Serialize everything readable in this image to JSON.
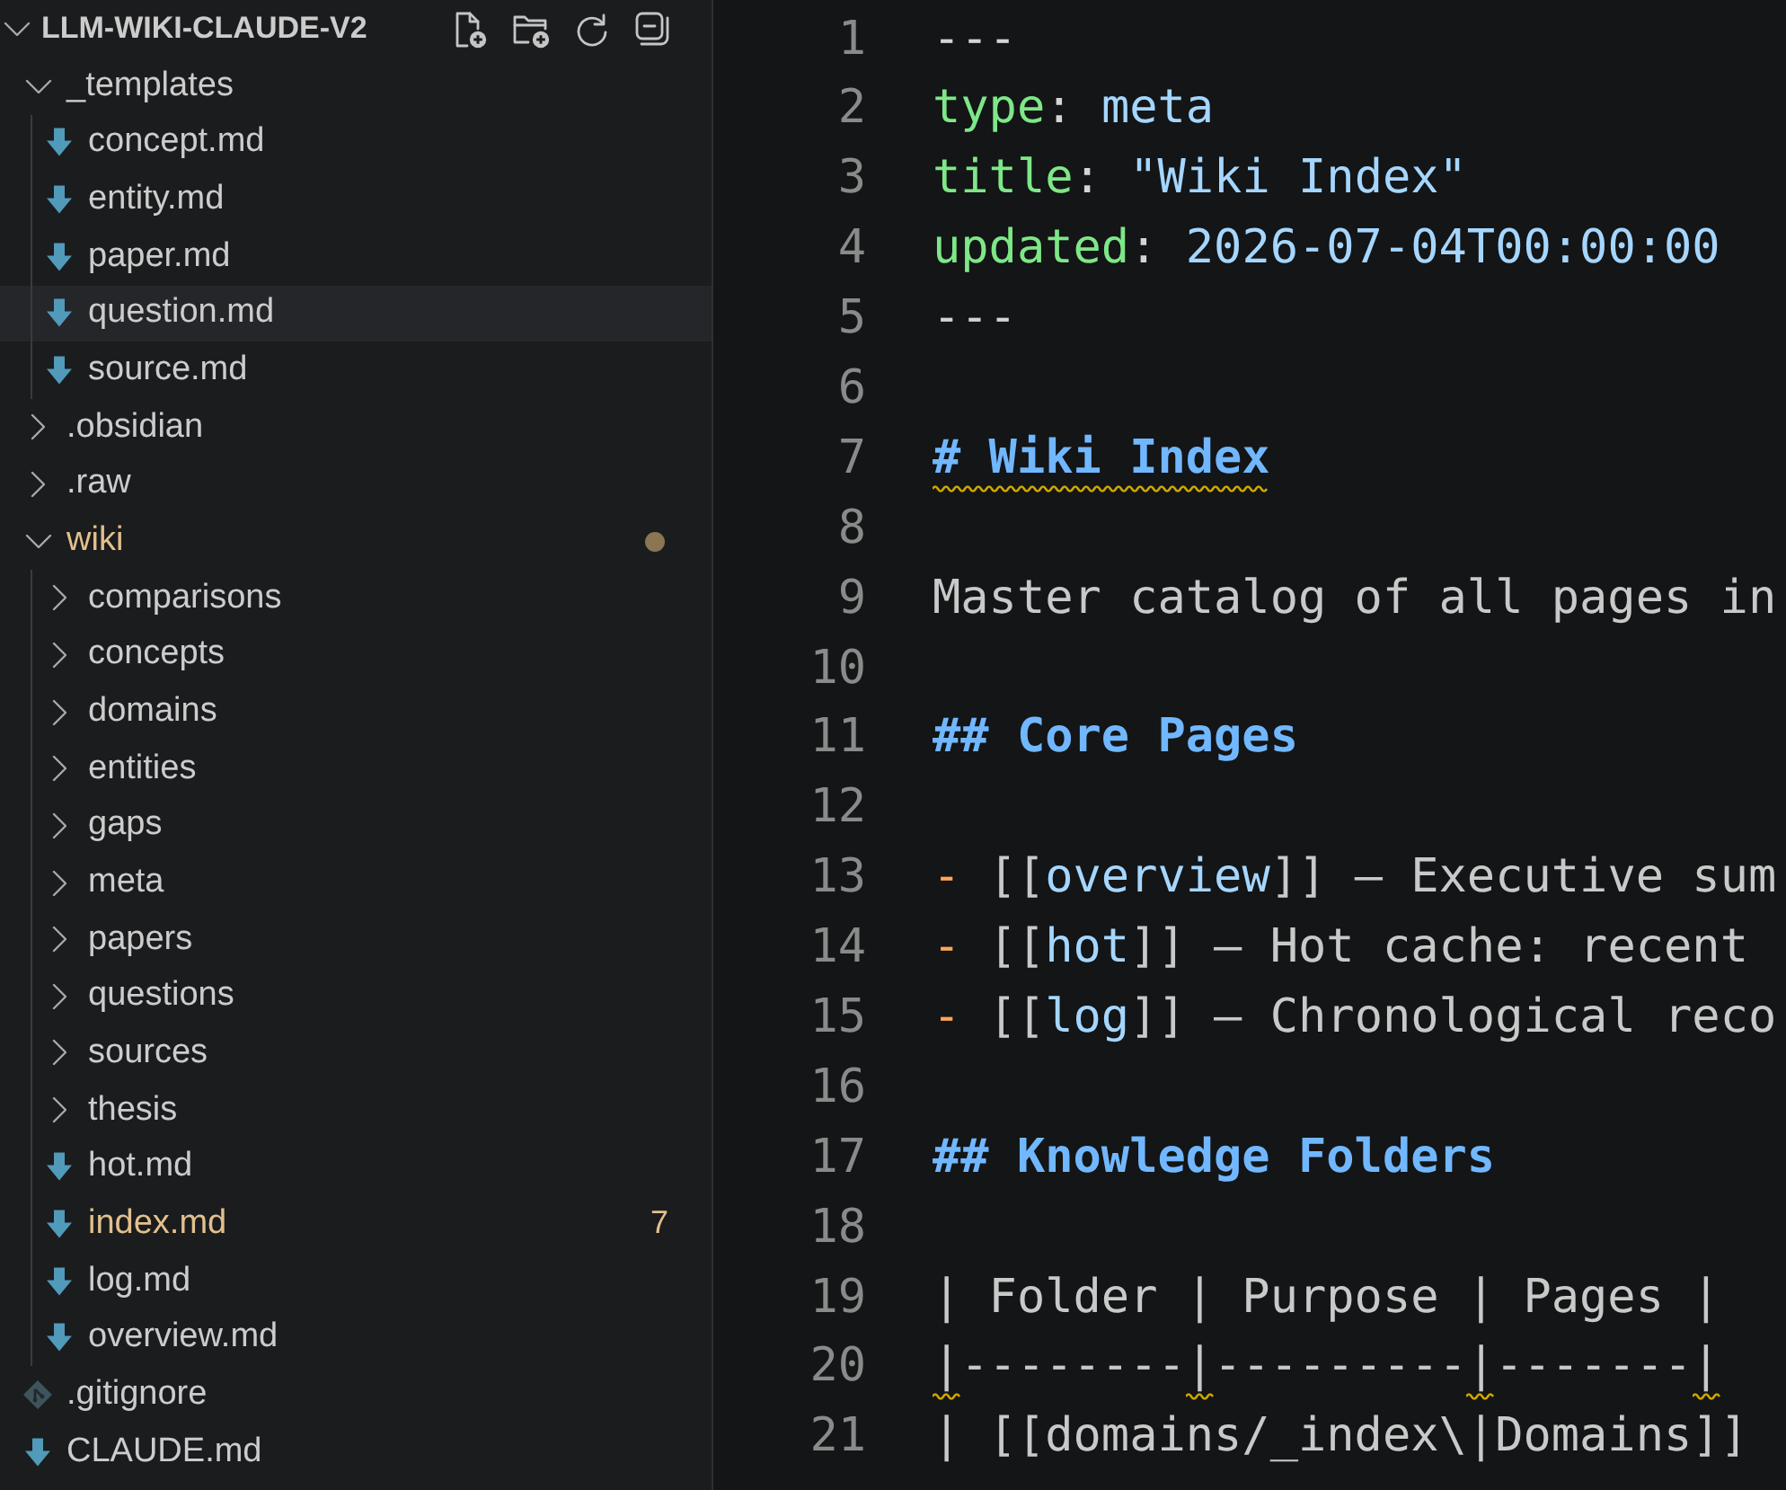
{
  "explorer": {
    "title": "LLM-WIKI-CLAUDE-V2",
    "expanded": true,
    "tree": [
      {
        "name": "_templates",
        "kind": "folder",
        "expanded": true,
        "selected": false,
        "modified": false,
        "children": [
          {
            "name": "concept.md",
            "kind": "markdown",
            "selected": false,
            "modified": false
          },
          {
            "name": "entity.md",
            "kind": "markdown",
            "selected": false,
            "modified": false
          },
          {
            "name": "paper.md",
            "kind": "markdown",
            "selected": false,
            "modified": false
          },
          {
            "name": "question.md",
            "kind": "markdown",
            "selected": true,
            "modified": false
          },
          {
            "name": "source.md",
            "kind": "markdown",
            "selected": false,
            "modified": false
          }
        ]
      },
      {
        "name": ".obsidian",
        "kind": "folder",
        "expanded": false,
        "selected": false,
        "modified": false
      },
      {
        "name": ".raw",
        "kind": "folder",
        "expanded": false,
        "selected": false,
        "modified": false
      },
      {
        "name": "wiki",
        "kind": "folder",
        "expanded": true,
        "selected": false,
        "modified": true,
        "children": [
          {
            "name": "comparisons",
            "kind": "folder",
            "expanded": false,
            "selected": false,
            "modified": false
          },
          {
            "name": "concepts",
            "kind": "folder",
            "expanded": false,
            "selected": false,
            "modified": false
          },
          {
            "name": "domains",
            "kind": "folder",
            "expanded": false,
            "selected": false,
            "modified": false
          },
          {
            "name": "entities",
            "kind": "folder",
            "expanded": false,
            "selected": false,
            "modified": false
          },
          {
            "name": "gaps",
            "kind": "folder",
            "expanded": false,
            "selected": false,
            "modified": false
          },
          {
            "name": "meta",
            "kind": "folder",
            "expanded": false,
            "selected": false,
            "modified": false
          },
          {
            "name": "papers",
            "kind": "folder",
            "expanded": false,
            "selected": false,
            "modified": false
          },
          {
            "name": "questions",
            "kind": "folder",
            "expanded": false,
            "selected": false,
            "modified": false
          },
          {
            "name": "sources",
            "kind": "folder",
            "expanded": false,
            "selected": false,
            "modified": false
          },
          {
            "name": "thesis",
            "kind": "folder",
            "expanded": false,
            "selected": false,
            "modified": false
          },
          {
            "name": "hot.md",
            "kind": "markdown",
            "selected": false,
            "modified": false
          },
          {
            "name": "index.md",
            "kind": "markdown",
            "selected": false,
            "modified": true,
            "badge": "7"
          },
          {
            "name": "log.md",
            "kind": "markdown",
            "selected": false,
            "modified": false
          },
          {
            "name": "overview.md",
            "kind": "markdown",
            "selected": false,
            "modified": false
          }
        ]
      },
      {
        "name": ".gitignore",
        "kind": "gitignore",
        "selected": false,
        "modified": false
      },
      {
        "name": "CLAUDE.md",
        "kind": "markdown",
        "selected": false,
        "modified": false
      }
    ]
  },
  "editor": {
    "lines": [
      {
        "number": "1",
        "tokens": [
          {
            "kind": "punct",
            "text": "---"
          }
        ]
      },
      {
        "number": "2",
        "tokens": [
          {
            "kind": "key",
            "text": "type"
          },
          {
            "kind": "punct",
            "text": ": "
          },
          {
            "kind": "value",
            "text": "meta"
          }
        ]
      },
      {
        "number": "3",
        "tokens": [
          {
            "kind": "key",
            "text": "title"
          },
          {
            "kind": "punct",
            "text": ": "
          },
          {
            "kind": "value",
            "text": "\"Wiki Index\""
          }
        ]
      },
      {
        "number": "4",
        "tokens": [
          {
            "kind": "key",
            "text": "updated"
          },
          {
            "kind": "punct",
            "text": ": "
          },
          {
            "kind": "value",
            "text": "2026-07-04T00:00:00"
          }
        ]
      },
      {
        "number": "5",
        "tokens": [
          {
            "kind": "punct",
            "text": "---"
          }
        ]
      },
      {
        "number": "6"
      },
      {
        "number": "7",
        "tokens": [
          {
            "kind": "heading",
            "text": "# Wiki Index",
            "warning": true
          }
        ]
      },
      {
        "number": "8"
      },
      {
        "number": "9",
        "tokens": [
          {
            "kind": "text",
            "text": "Master catalog of all pages in"
          }
        ]
      },
      {
        "number": "10"
      },
      {
        "number": "11",
        "tokens": [
          {
            "kind": "heading",
            "text": "## Core Pages"
          }
        ]
      },
      {
        "number": "12"
      },
      {
        "number": "13",
        "tokens": [
          {
            "kind": "bullet",
            "text": "-"
          },
          {
            "kind": "text",
            "text": " [["
          },
          {
            "kind": "link",
            "text": "overview"
          },
          {
            "kind": "text",
            "text": "]] — Executive sum"
          }
        ]
      },
      {
        "number": "14",
        "tokens": [
          {
            "kind": "bullet",
            "text": "-"
          },
          {
            "kind": "text",
            "text": " [["
          },
          {
            "kind": "link",
            "text": "hot"
          },
          {
            "kind": "text",
            "text": "]] — Hot cache: recent"
          }
        ]
      },
      {
        "number": "15",
        "tokens": [
          {
            "kind": "bullet",
            "text": "-"
          },
          {
            "kind": "text",
            "text": " [["
          },
          {
            "kind": "link",
            "text": "log"
          },
          {
            "kind": "text",
            "text": "]] — Chronological reco"
          }
        ]
      },
      {
        "number": "16"
      },
      {
        "number": "17",
        "tokens": [
          {
            "kind": "heading",
            "text": "## Knowledge Folders"
          }
        ]
      },
      {
        "number": "18"
      },
      {
        "number": "19",
        "tokens": [
          {
            "kind": "text",
            "text": "| Folder | Purpose | Pages |"
          }
        ]
      },
      {
        "number": "20",
        "tokens": [
          {
            "kind": "text",
            "text": "|",
            "warning": true
          },
          {
            "kind": "text",
            "text": "--------"
          },
          {
            "kind": "text",
            "text": "|",
            "warning": true
          },
          {
            "kind": "text",
            "text": "---------"
          },
          {
            "kind": "text",
            "text": "|",
            "warning": true
          },
          {
            "kind": "text",
            "text": "-------"
          },
          {
            "kind": "text",
            "text": "|",
            "warning": true
          }
        ]
      },
      {
        "number": "21",
        "tokens": [
          {
            "kind": "text",
            "text": "| [[domains/_index\\|Domains]]"
          }
        ]
      }
    ]
  }
}
